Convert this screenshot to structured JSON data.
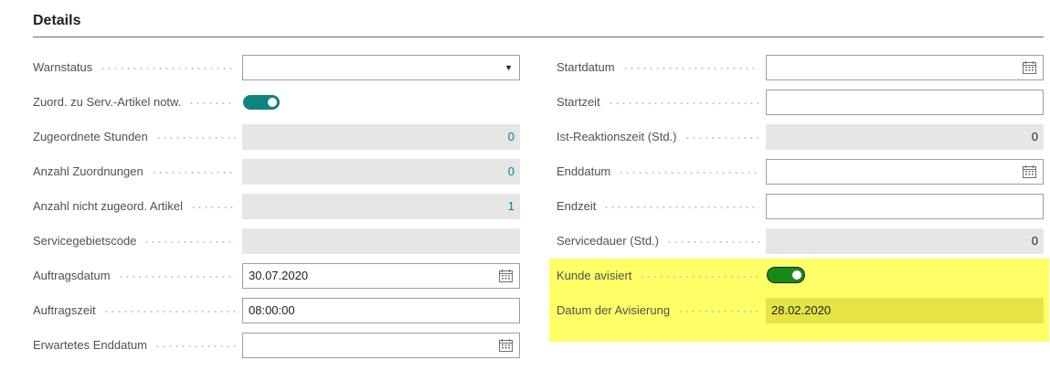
{
  "section": {
    "title": "Details"
  },
  "left_fields": [
    {
      "label": "Warnstatus",
      "value": "",
      "kind": "select"
    },
    {
      "label": "Zuord. zu Serv.-Artikel notw.",
      "value": "on",
      "kind": "toggle"
    },
    {
      "label": "Zugeordnete Stunden",
      "value": "0",
      "kind": "readonly-teal"
    },
    {
      "label": "Anzahl Zuordnungen",
      "value": "0",
      "kind": "readonly-teal"
    },
    {
      "label": "Anzahl nicht zugeord. Artikel",
      "value": "1",
      "kind": "readonly-teal"
    },
    {
      "label": "Servicegebietscode",
      "value": "",
      "kind": "readonly"
    },
    {
      "label": "Auftragsdatum",
      "value": "30.07.2020",
      "kind": "date"
    },
    {
      "label": "Auftragszeit",
      "value": "08:00:00",
      "kind": "text"
    },
    {
      "label": "Erwartetes Enddatum",
      "value": "",
      "kind": "date"
    }
  ],
  "right_fields": [
    {
      "label": "Startdatum",
      "value": "",
      "kind": "date"
    },
    {
      "label": "Startzeit",
      "value": "",
      "kind": "text"
    },
    {
      "label": "Ist-Reaktionszeit (Std.)",
      "value": "0",
      "kind": "readonly"
    },
    {
      "label": "Enddatum",
      "value": "",
      "kind": "date"
    },
    {
      "label": "Endzeit",
      "value": "",
      "kind": "text"
    },
    {
      "label": "Servicedauer (Std.)",
      "value": "0",
      "kind": "readonly"
    },
    {
      "label": "Kunde avisiert",
      "value": "on",
      "kind": "toggle-green"
    },
    {
      "label": "Datum der Avisierung",
      "value": "28.02.2020",
      "kind": "readonly-yellow"
    }
  ],
  "icons": {
    "calendar": "calendar-icon",
    "dropdown": "chevron-down-icon"
  },
  "colors": {
    "toggle_teal": "#118282",
    "toggle_green": "#178a17",
    "highlight": "#ffff66",
    "teal_value": "#00828c"
  }
}
